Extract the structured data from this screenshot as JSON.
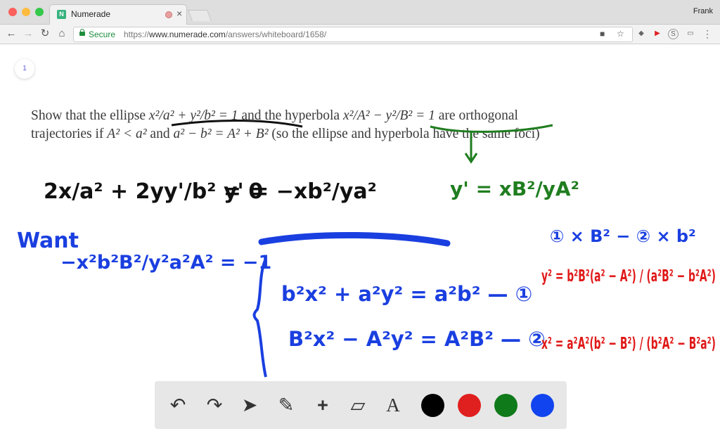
{
  "browser": {
    "tab_title": "Numerade",
    "tab_favicon": "N",
    "user_name": "Frank",
    "secure_label": "Secure",
    "url_scheme": "https://",
    "url_host": "www.numerade.com",
    "url_path": "/answers/whiteboard/1658/"
  },
  "page": {
    "page_number": "1",
    "problem_line1_pre": "Show that the ellipse ",
    "problem_ellipse": "x²/a² + y²/b² = 1",
    "problem_mid": " and the hyperbola ",
    "problem_hyperbola": "x²/A² − y²/B² = 1",
    "problem_line1_post": " are orthogonal",
    "problem_line2_pre": "trajectories if ",
    "problem_cond1": "A² < a²",
    "problem_and": " and ",
    "problem_cond2": "a² − b² = A² + B²",
    "problem_line2_post": " (so the ellipse and hyperbola have the same foci)"
  },
  "handwriting": {
    "black_eq1": "2x/a² + 2yy'/b² = 0",
    "black_eq2": "y' = −xb²/ya²",
    "green_eq": "y' = xB²/yA²",
    "blue_want": "Want",
    "blue_frac": "−x²b²B²/y²a²A² = −1",
    "blue_sys1": "b²x² + a²y² = a²b² — ①",
    "blue_sys2": "B²x² − A²y² = A²B² — ②",
    "blue_combo": "① × B² − ② × b²",
    "red_y": "y² = b²B²(a² − A²) / (a²B² − b²A²)",
    "red_x": "x² = a²A²(b² − B²) / (b²A² − B²a²)"
  },
  "draw_toolbar": {
    "tools": [
      "undo-icon",
      "redo-icon",
      "pointer-icon",
      "pencil-icon",
      "plus-icon",
      "eraser-icon",
      "text-icon"
    ],
    "text_tool_label": "A",
    "colors": [
      "#000000",
      "#e01f1f",
      "#0f7a1a",
      "#1144ee"
    ]
  },
  "colors": {
    "ink_black": "#111111",
    "ink_green": "#1f7d1f",
    "ink_blue": "#1a3fe0",
    "ink_red": "#e01818"
  }
}
